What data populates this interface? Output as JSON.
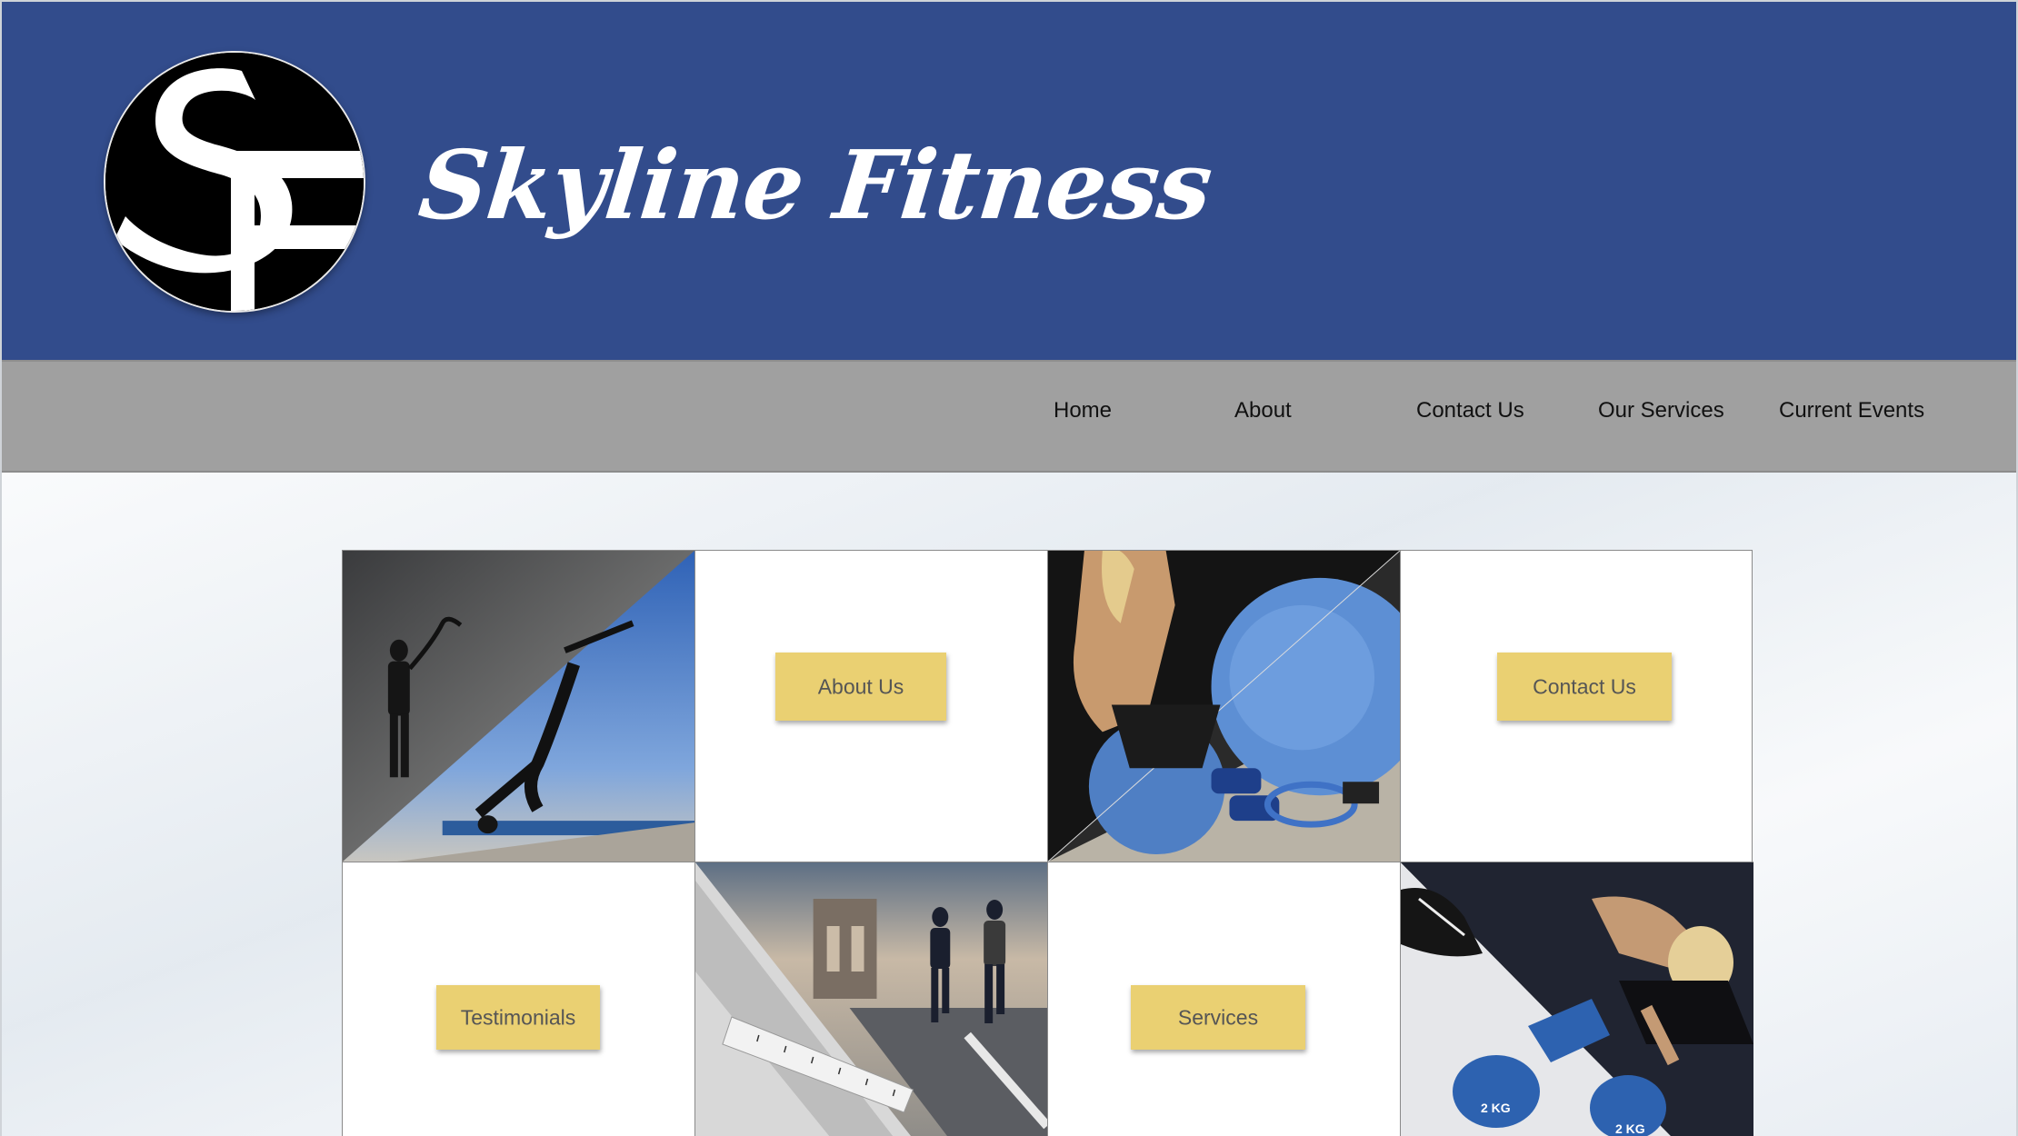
{
  "header": {
    "logo_text": "SF",
    "site_title": "Skyline Fitness",
    "background_color": "#324c8c"
  },
  "nav": {
    "items": [
      {
        "label": "Home"
      },
      {
        "label": "About"
      },
      {
        "label": "Contact Us"
      },
      {
        "label": "Our Services"
      },
      {
        "label": "Current Events"
      }
    ],
    "background_color": "#a0a0a0"
  },
  "grid": {
    "buttons": {
      "about": "About Us",
      "contact": "Contact Us",
      "testimonials": "Testimonials",
      "services": "Services"
    },
    "button_color": "#ead072",
    "photos": [
      {
        "name": "battle-ropes-and-yoga-photo"
      },
      {
        "name": "woman-with-exercise-ball-and-dumbbells-photo"
      },
      {
        "name": "bridge-runners-and-tape-measure-photo"
      },
      {
        "name": "sneakers-dumbbells-and-situps-photo"
      }
    ],
    "dumbbell_labels": [
      "2 KG",
      "2 KG"
    ]
  }
}
